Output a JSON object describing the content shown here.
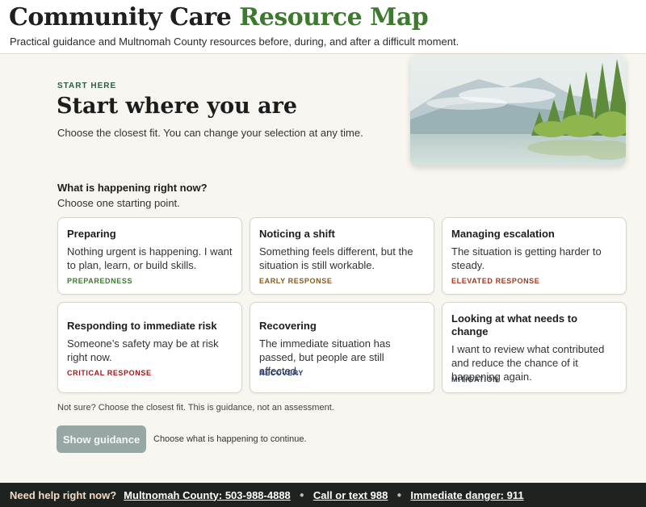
{
  "header": {
    "title_main": "Community Care",
    "title_accent": "Resource Map",
    "subtitle": "Practical guidance and Multnomah County resources before, during, and after a difficult moment."
  },
  "intro": {
    "eyebrow": "START HERE",
    "title": "Start where you are",
    "lead": "Choose the closest fit. You can change your selection at any time."
  },
  "question": {
    "title": "What is happening right now?",
    "subtitle": "Choose one starting point."
  },
  "cards": [
    {
      "title": "Preparing",
      "desc": "Nothing urgent is happening. I want to plan, learn, or build skills.",
      "tag": "PREPAREDNESS",
      "tag_color": "#3d7a30"
    },
    {
      "title": "Noticing a shift",
      "desc": "Something feels different, but the situation is still workable.",
      "tag": "EARLY RESPONSE",
      "tag_color": "#8a5a1c"
    },
    {
      "title": "Managing escalation",
      "desc": "The situation is getting harder to steady.",
      "tag": "ELEVATED RESPONSE",
      "tag_color": "#a13a21"
    },
    {
      "title": "Responding to immediate risk",
      "desc": "Someone’s safety may be at risk right now.",
      "tag": "CRITICAL RESPONSE",
      "tag_color": "#a4161a"
    },
    {
      "title": "Recovering",
      "desc": "The immediate situation has passed, but people are still affected.",
      "tag": "RECOVERY",
      "tag_color": "#1f3f8a"
    },
    {
      "title": "Looking at what needs to change",
      "desc": "I want to review what contributed and reduce the chance of it happening again.",
      "tag": "MITIGATION",
      "tag_color": "#2f3b44"
    }
  ],
  "note": "Not sure? Choose the closest fit. This is guidance, not an assessment.",
  "action": {
    "button_label": "Show guidance",
    "hint": "Choose what is happening to continue."
  },
  "footer": {
    "lead": "Need help right now?",
    "links": [
      "Multnomah County: 503-988-4888",
      "Call or text 988",
      "Immediate danger: 911"
    ]
  },
  "colors": {
    "accent": "#3d7a30",
    "background": "#f8f6f0",
    "footer_bg": "#1f2320",
    "button_disabled": "#97a7a3"
  }
}
